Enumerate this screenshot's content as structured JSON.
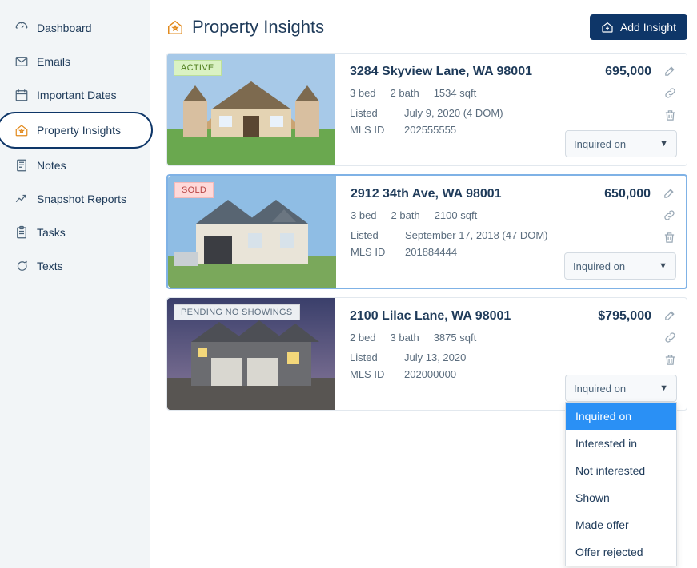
{
  "sidebar": {
    "items": [
      {
        "label": "Dashboard",
        "icon": "dashboard-icon"
      },
      {
        "label": "Emails",
        "icon": "mail-icon"
      },
      {
        "label": "Important Dates",
        "icon": "calendar-icon"
      },
      {
        "label": "Property Insights",
        "icon": "house-star-icon",
        "active": true
      },
      {
        "label": "Notes",
        "icon": "note-icon"
      },
      {
        "label": "Snapshot Reports",
        "icon": "chart-icon"
      },
      {
        "label": "Tasks",
        "icon": "clipboard-icon"
      },
      {
        "label": "Texts",
        "icon": "chat-icon"
      }
    ]
  },
  "header": {
    "title": "Property Insights",
    "add_button": "Add Insight"
  },
  "properties": [
    {
      "status": "ACTIVE",
      "status_class": "badge-active",
      "address": "3284 Skyview Lane, WA 98001",
      "price": "695,000",
      "bed": "3 bed",
      "bath": "2 bath",
      "sqft": "1534 sqft",
      "listed_label": "Listed",
      "listed_value": "July 9, 2020 (4 DOM)",
      "mls_label": "MLS ID",
      "mls_value": "202555555",
      "select_label": "Inquired on"
    },
    {
      "status": "SOLD",
      "status_class": "badge-sold",
      "selected": true,
      "address": "2912 34th Ave, WA 98001",
      "price": "650,000",
      "bed": "3 bed",
      "bath": "2 bath",
      "sqft": "2100 sqft",
      "listed_label": "Listed",
      "listed_value": "September 17, 2018 (47 DOM)",
      "mls_label": "MLS ID",
      "mls_value": "201884444",
      "select_label": "Inquired on"
    },
    {
      "status": "PENDING NO SHOWINGS",
      "status_class": "badge-pending",
      "address": "2100 Lilac Lane, WA 98001",
      "price": "$795,000",
      "bed": "2 bed",
      "bath": "3 bath",
      "sqft": "3875 sqft",
      "listed_label": "Listed",
      "listed_value": "July 13, 2020",
      "mls_label": "MLS ID",
      "mls_value": "202000000",
      "select_label": "Inquired on",
      "dropdown_open": true
    }
  ],
  "dropdown_options": [
    "Inquired on",
    "Interested in",
    "Not interested",
    "Shown",
    "Made offer",
    "Offer rejected"
  ]
}
